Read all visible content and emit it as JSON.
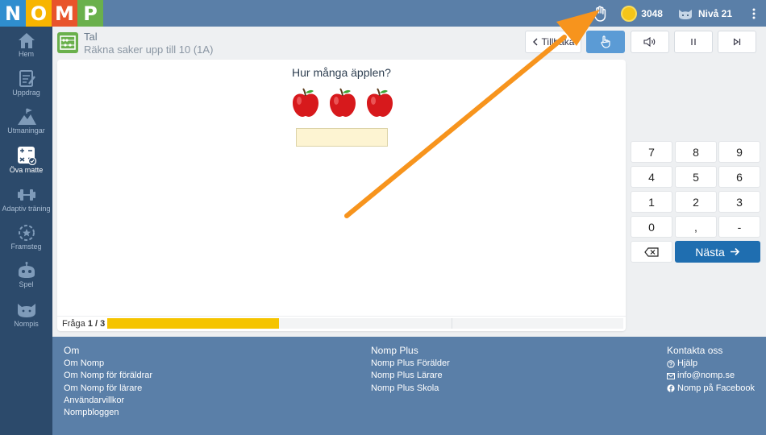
{
  "app": {
    "logo_letters": [
      {
        "letter": "N",
        "color": "#2f8ecf"
      },
      {
        "letter": "O",
        "color": "#f7b500"
      },
      {
        "letter": "M",
        "color": "#e8542b"
      },
      {
        "letter": "P",
        "color": "#6ab04c"
      }
    ],
    "coins": "3048",
    "level": "Nivå 21"
  },
  "sidebar": {
    "items": [
      {
        "label": "Hem",
        "icon": "home-icon"
      },
      {
        "label": "Uppdrag",
        "icon": "assignment-icon"
      },
      {
        "label": "Utmaningar",
        "icon": "mountain-icon"
      },
      {
        "label": "Öva matte",
        "icon": "calculator-icon",
        "active": true
      },
      {
        "label": "Adaptiv träning",
        "icon": "dumbbell-icon"
      },
      {
        "label": "Framsteg",
        "icon": "progress-star-icon"
      },
      {
        "label": "Spel",
        "icon": "game-robot-icon"
      },
      {
        "label": "Nompis",
        "icon": "cat-icon"
      }
    ]
  },
  "header": {
    "category": "Tal",
    "task_name": "Räkna saker upp till 10 (1A)",
    "back_label": "Tillbaka"
  },
  "exercise": {
    "question": "Hur många äpplen?",
    "apple_count": 3,
    "answer_value": "",
    "progress_label": "Fråga",
    "progress_value": "1 / 3",
    "progress_fraction": 0.333
  },
  "keypad": {
    "keys": [
      "7",
      "8",
      "9",
      "4",
      "5",
      "6",
      "1",
      "2",
      "3",
      "0",
      ",",
      "-"
    ],
    "next_label": "Nästa"
  },
  "footer": {
    "col1": {
      "heading": "Om",
      "links": [
        "Om Nomp",
        "Om Nomp för föräldrar",
        "Om Nomp för lärare",
        "Användarvillkor",
        "Nompbloggen"
      ]
    },
    "col2": {
      "heading": "Nomp Plus",
      "links": [
        "Nomp Plus Förälder",
        "Nomp Plus Lärare",
        "Nomp Plus Skola"
      ]
    },
    "col3": {
      "heading": "Kontakta oss",
      "links": [
        {
          "label": "Hjälp",
          "icon": "question-circle-icon"
        },
        {
          "label": "info@nomp.se",
          "icon": "envelope-icon"
        },
        {
          "label": "Nomp på Facebook",
          "icon": "facebook-icon"
        }
      ]
    }
  },
  "colors": {
    "topbar": "#5a7fa8",
    "sidebar": "#2c4a6b",
    "accent_button": "#1f6eb0",
    "progress": "#f5c400",
    "annotation_arrow": "#f7941d"
  }
}
